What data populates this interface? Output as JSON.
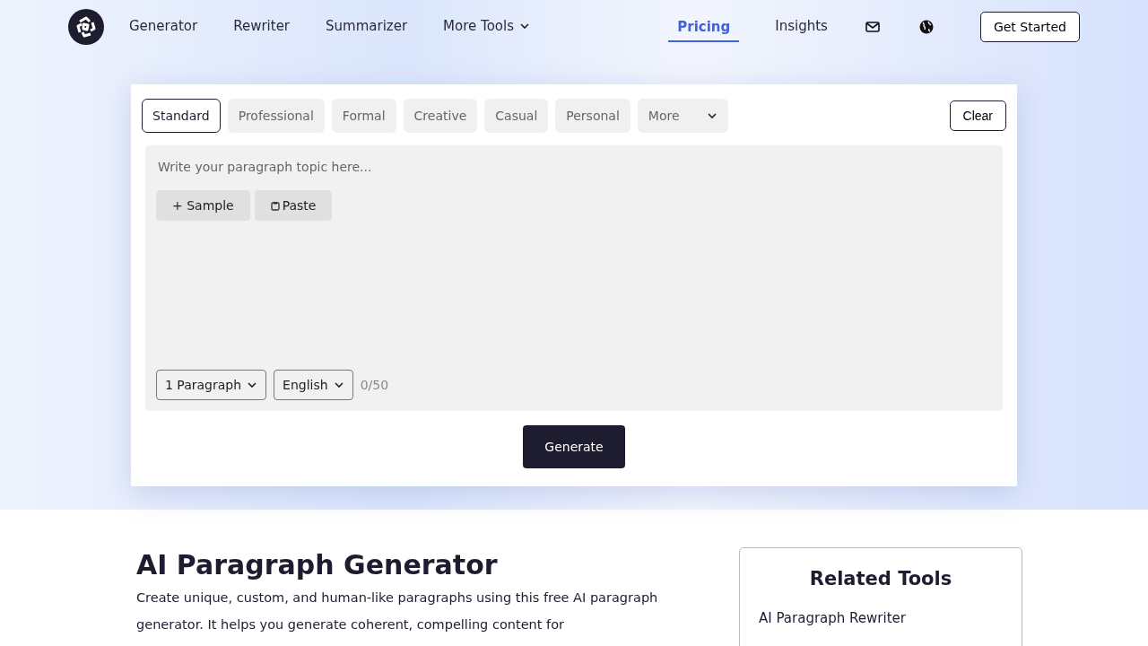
{
  "nav": {
    "links": [
      {
        "label": "Generator",
        "dropdown": false,
        "selected": false
      },
      {
        "label": "Rewriter",
        "dropdown": false,
        "selected": false
      },
      {
        "label": "Summarizer",
        "dropdown": false,
        "selected": false
      },
      {
        "label": "More Tools",
        "dropdown": true,
        "selected": false
      },
      {
        "label": "Pricing",
        "dropdown": false,
        "selected": true
      },
      {
        "label": "Insights",
        "dropdown": false,
        "selected": false
      }
    ],
    "cta": "Get Started"
  },
  "tones": [
    {
      "label": "Standard",
      "selected": true
    },
    {
      "label": "Professional",
      "selected": false
    },
    {
      "label": "Formal",
      "selected": false
    },
    {
      "label": "Creative",
      "selected": false
    },
    {
      "label": "Casual",
      "selected": false
    },
    {
      "label": "Personal",
      "selected": false
    }
  ],
  "more_tones": "More",
  "clear": "Clear",
  "editor": {
    "placeholder": "Write your paragraph topic here...",
    "sample": "+ Sample",
    "paste": "Paste",
    "length": "1 Paragraph",
    "language": "English",
    "count": "0/50"
  },
  "generate": "Generate",
  "article": {
    "title": "AI Paragraph Generator",
    "text": "Create unique, custom, and human-like paragraphs using this free AI paragraph generator. It helps you generate coherent, compelling content for"
  },
  "related": {
    "title": "Related Tools",
    "items": [
      "AI Paragraph Rewriter"
    ]
  }
}
